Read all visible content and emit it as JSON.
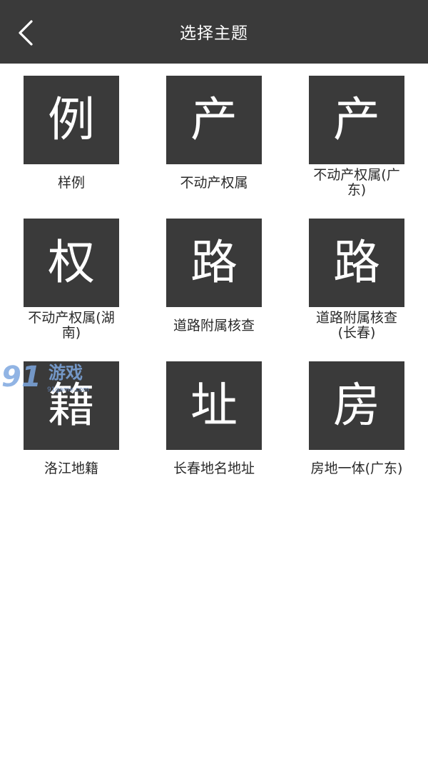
{
  "header": {
    "title": "选择主题",
    "back_icon": "chevron-left-icon"
  },
  "themes": [
    {
      "glyph": "例",
      "label": "样例"
    },
    {
      "glyph": "产",
      "label": "不动产权属"
    },
    {
      "glyph": "产",
      "label": "不动产权属(广东)"
    },
    {
      "glyph": "权",
      "label": "不动产权属(湖南)"
    },
    {
      "glyph": "路",
      "label": "道路附属核查"
    },
    {
      "glyph": "路",
      "label": "道路附属核查(长春)"
    },
    {
      "glyph": "籍",
      "label": "洛江地籍"
    },
    {
      "glyph": "址",
      "label": "长春地名地址"
    },
    {
      "glyph": "房",
      "label": "房地一体(广东)"
    }
  ],
  "watermark": {
    "number": "91",
    "text": "游戏",
    "url": "91game.com"
  },
  "colors": {
    "header_bg": "#3a3a3a",
    "tile_bg": "#3a3a3a",
    "page_bg": "#ffffff",
    "label_text": "#2a2a2a"
  }
}
